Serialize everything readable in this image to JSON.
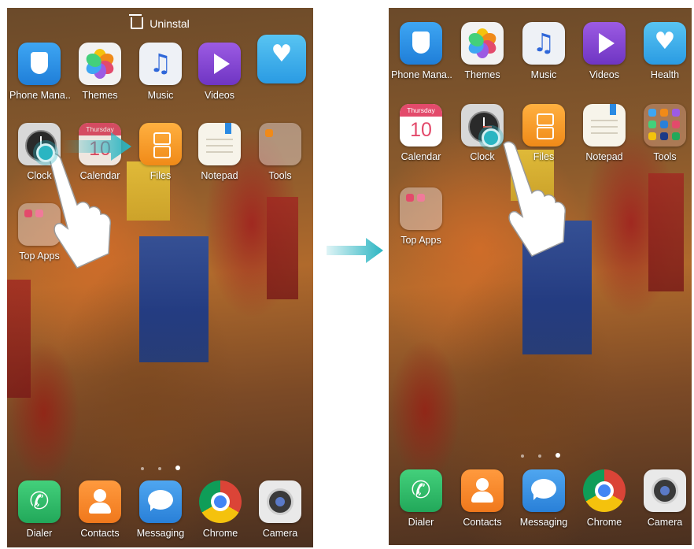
{
  "colors": {
    "accent": "#2ab5c2"
  },
  "left_screen": {
    "uninstall_label": "Uninstal",
    "apps_row1": [
      "Phone Mana..",
      "Themes",
      "Music",
      "Videos"
    ],
    "apps_row2": [
      "Clock",
      "Calendar",
      "Files",
      "Notepad",
      "Tools"
    ],
    "apps_row3": [
      "Top Apps"
    ],
    "calendar": {
      "weekday": "Thursday",
      "day": "10"
    },
    "dock": [
      "Dialer",
      "Contacts",
      "Messaging",
      "Chrome",
      "Camera"
    ],
    "page_indicator": {
      "pages": 3,
      "current": 3
    }
  },
  "right_screen": {
    "apps_row1": [
      "Phone Mana..",
      "Themes",
      "Music",
      "Videos",
      "Health"
    ],
    "apps_row2": [
      "Calendar",
      "Clock",
      "Files",
      "Notepad",
      "Tools"
    ],
    "apps_row3": [
      "Top Apps"
    ],
    "calendar": {
      "weekday": "Thursday",
      "day": "10"
    },
    "dock": [
      "Dialer",
      "Contacts",
      "Messaging",
      "Chrome",
      "Camera"
    ],
    "page_indicator": {
      "pages": 3,
      "current": 3
    }
  },
  "icons": {
    "transition": "arrow-right-icon",
    "gesture": "hand-pointer-icon",
    "drag": "drag-arrow-icon",
    "uninstall": "trash-icon"
  }
}
